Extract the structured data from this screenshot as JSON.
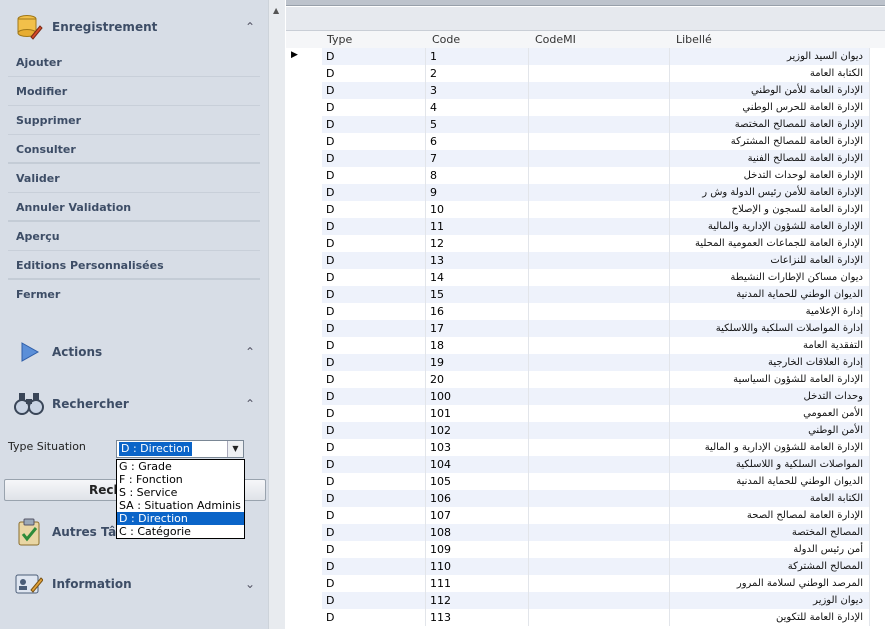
{
  "sidebar": {
    "enregistrement": {
      "title": "Enregistrement",
      "items": [
        "Ajouter",
        "Modifier",
        "Supprimer",
        "Consulter",
        "Valider",
        "Annuler Validation",
        "Aperçu",
        "Editions Personnalisées",
        "Fermer"
      ]
    },
    "actions": {
      "title": "Actions"
    },
    "rechercher": {
      "title": "Rechercher"
    },
    "type_situation": {
      "label": "Type Situation",
      "selected": "D : Direction",
      "options": [
        "G : Grade",
        "F : Fonction",
        "S : Service",
        "SA : Situation Adminis",
        "D : Direction",
        "C : Catégorie"
      ],
      "active_index": 4
    },
    "search_button": "Rech",
    "autres": {
      "title": "Autres Tâc"
    },
    "information": {
      "title": "Information"
    }
  },
  "grid": {
    "columns": [
      "Type",
      "Code",
      "CodeMI",
      "Libellé"
    ],
    "rows": [
      {
        "type": "D",
        "code": "1",
        "codemi": "",
        "libelle": "ديوان السيد الوزير"
      },
      {
        "type": "D",
        "code": "2",
        "codemi": "",
        "libelle": "الكتابة العامة"
      },
      {
        "type": "D",
        "code": "3",
        "codemi": "",
        "libelle": "الإدارة العامة للأمن الوطني"
      },
      {
        "type": "D",
        "code": "4",
        "codemi": "",
        "libelle": "الإدارة العامة للحرس الوطني"
      },
      {
        "type": "D",
        "code": "5",
        "codemi": "",
        "libelle": "الإدارة العامة للمصالح المختصة"
      },
      {
        "type": "D",
        "code": "6",
        "codemi": "",
        "libelle": "الإدارة العامة للمصالح المشتركة"
      },
      {
        "type": "D",
        "code": "7",
        "codemi": "",
        "libelle": "الإدارة العامة للمصالح الفنية"
      },
      {
        "type": "D",
        "code": "8",
        "codemi": "",
        "libelle": "الإدارة العامة لوحدات التدخل"
      },
      {
        "type": "D",
        "code": "9",
        "codemi": "",
        "libelle": "الإدارة العامة للأمن رئيس الدولة وش ر"
      },
      {
        "type": "D",
        "code": "10",
        "codemi": "",
        "libelle": "الإدارة العامة للسجون و الإصلاح"
      },
      {
        "type": "D",
        "code": "11",
        "codemi": "",
        "libelle": "الإدارة العامة للشؤون الإدارية والمالية"
      },
      {
        "type": "D",
        "code": "12",
        "codemi": "",
        "libelle": "الإدارة العامة للجماعات العمومية المحلية"
      },
      {
        "type": "D",
        "code": "13",
        "codemi": "",
        "libelle": "الإدارة العامة للنزاعات"
      },
      {
        "type": "D",
        "code": "14",
        "codemi": "",
        "libelle": "ديوان مساكن الإطارات النشيطة"
      },
      {
        "type": "D",
        "code": "15",
        "codemi": "",
        "libelle": "الديوان الوطني للحماية المدنية"
      },
      {
        "type": "D",
        "code": "16",
        "codemi": "",
        "libelle": "إدارة الإعلامية"
      },
      {
        "type": "D",
        "code": "17",
        "codemi": "",
        "libelle": "إدارة المواصلات السلكية واللاسلكية"
      },
      {
        "type": "D",
        "code": "18",
        "codemi": "",
        "libelle": "التفقدية العامة"
      },
      {
        "type": "D",
        "code": "19",
        "codemi": "",
        "libelle": "إدارة العلاقات الخارجية"
      },
      {
        "type": "D",
        "code": "20",
        "codemi": "",
        "libelle": "الإدارة العامة للشؤون السياسية"
      },
      {
        "type": "D",
        "code": "100",
        "codemi": "",
        "libelle": "وحدات التدخل"
      },
      {
        "type": "D",
        "code": "101",
        "codemi": "",
        "libelle": "الأمن العمومي"
      },
      {
        "type": "D",
        "code": "102",
        "codemi": "",
        "libelle": "الأمن الوطني"
      },
      {
        "type": "D",
        "code": "103",
        "codemi": "",
        "libelle": "الإدارة العامة للشؤون الإدارية و المالية"
      },
      {
        "type": "D",
        "code": "104",
        "codemi": "",
        "libelle": "المواصلات السلكية و اللاسلكية"
      },
      {
        "type": "D",
        "code": "105",
        "codemi": "",
        "libelle": "الديوان الوطني للحماية المدنية"
      },
      {
        "type": "D",
        "code": "106",
        "codemi": "",
        "libelle": "الكتابة العامة"
      },
      {
        "type": "D",
        "code": "107",
        "codemi": "",
        "libelle": "الإدارة العامة لمصالح الصحة"
      },
      {
        "type": "D",
        "code": "108",
        "codemi": "",
        "libelle": "المصالح المختصة"
      },
      {
        "type": "D",
        "code": "109",
        "codemi": "",
        "libelle": "أمن رئيس الدولة"
      },
      {
        "type": "D",
        "code": "110",
        "codemi": "",
        "libelle": "المصالح المشتركة"
      },
      {
        "type": "D",
        "code": "111",
        "codemi": "",
        "libelle": "المرصد الوطني لسلامة المرور"
      },
      {
        "type": "D",
        "code": "112",
        "codemi": "",
        "libelle": "ديوان الوزير"
      },
      {
        "type": "D",
        "code": "113",
        "codemi": "",
        "libelle": "الإدارة العامة للتكوين"
      }
    ]
  },
  "colors": {
    "accent": "#0a64c8",
    "sidebar_bg": "#d7dde6",
    "menu_text": "#3d4d66",
    "alt_row": "#eef2fb"
  },
  "icons": {
    "enregistrement": "database-edit-icon",
    "actions": "play-triangle-icon",
    "rechercher": "binoculars-icon",
    "autres": "clipboard-check-icon",
    "information": "info-card-icon"
  }
}
